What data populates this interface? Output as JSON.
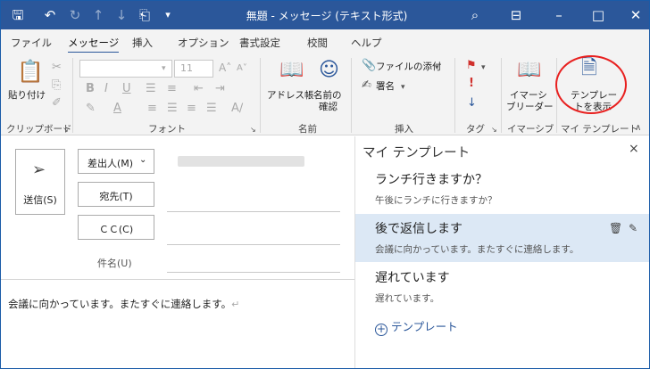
{
  "title": "無題 - メッセージ (テキスト形式)",
  "menu": [
    "ファイル",
    "メッセージ",
    "挿入",
    "オプション",
    "書式設定",
    "校閲",
    "ヘルプ"
  ],
  "ribbon": {
    "paste": "貼り付け",
    "font_size": "11",
    "address_book": "アドレス帳",
    "check_names_1": "名前の",
    "check_names_2": "確認",
    "attach_file": "ファイルの添付",
    "signature": "署名",
    "immersive_1": "イマーシ",
    "immersive_2": "ブリーダー",
    "show_templates_1": "テンプレー",
    "show_templates_2": "トを表示",
    "groups": [
      "クリップボード",
      "フォント",
      "名前",
      "挿入",
      "タグ",
      "イマーシブ",
      "マイ テンプレート"
    ]
  },
  "compose": {
    "send": "送信(S)",
    "from": "差出人(M)",
    "to": "宛先(T)",
    "cc": "ＣＣ(C)",
    "subject": "件名(U)",
    "body": "会議に向かっています。またすぐに連絡します。"
  },
  "panel": {
    "title": "マイ テンプレート",
    "close": "×",
    "templates": [
      {
        "title": "ランチ行きますか？",
        "preview": "午後にランチに行きますか？",
        "selected": false
      },
      {
        "title": "後で返信します",
        "preview": "会議に向かっています。またすぐに連絡します。",
        "selected": true
      },
      {
        "title": "遅れています",
        "preview": "遅れています。",
        "selected": false
      }
    ],
    "add": "テンプレート"
  },
  "colors": {
    "titlebar": "#2b579a",
    "accent": "#2b579a",
    "highlight": "#e8201f"
  }
}
